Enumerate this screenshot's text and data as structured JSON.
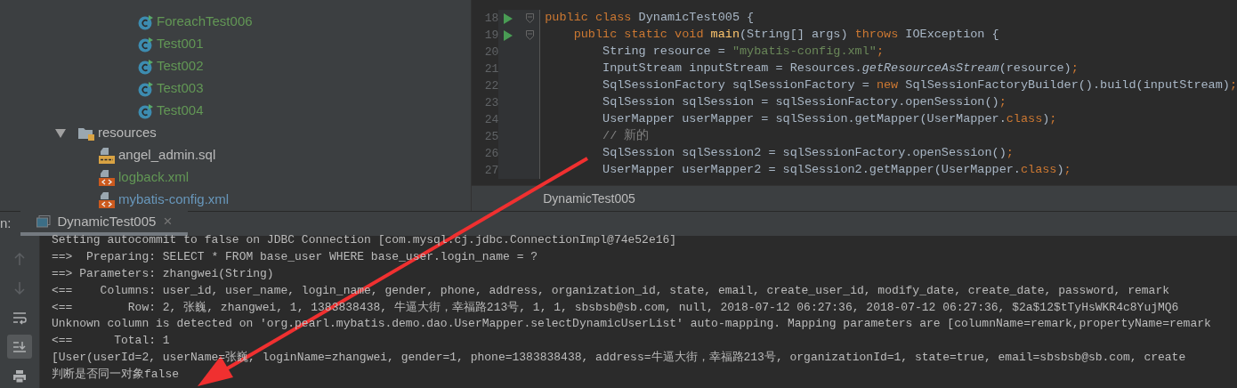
{
  "project_tree": [
    {
      "label": "ForeachTest006",
      "kind": "class",
      "selected": false,
      "color": "#629755"
    },
    {
      "label": "Test001",
      "kind": "class",
      "selected": false,
      "color": "#629755"
    },
    {
      "label": "Test002",
      "kind": "class",
      "selected": false,
      "color": "#629755"
    },
    {
      "label": "Test003",
      "kind": "class",
      "selected": false,
      "color": "#629755"
    },
    {
      "label": "Test004",
      "kind": "class",
      "selected": false,
      "color": "#629755"
    },
    {
      "label": "resources",
      "kind": "folder",
      "selected": false,
      "expanded": true,
      "color": "#bbbbbb",
      "children": [
        {
          "label": "angel_admin.sql",
          "kind": "sql",
          "selected": false,
          "color": "#bbbbbb"
        },
        {
          "label": "logback.xml",
          "kind": "xml",
          "selected": false,
          "color": "#629755"
        },
        {
          "label": "mybatis-config.xml",
          "kind": "xml",
          "selected": false,
          "color": "#6897bb"
        }
      ]
    }
  ],
  "editor": {
    "lines": [
      {
        "number": "18",
        "runnable": true,
        "foldable": true,
        "tokens": [
          {
            "kind": "keyword",
            "text": "public class "
          },
          {
            "kind": "plain",
            "text": "DynamicTest005 {"
          }
        ]
      },
      {
        "number": "19",
        "runnable": true,
        "foldable": true,
        "tokens": [
          {
            "kind": "keyword",
            "text": "    public static void "
          },
          {
            "kind": "method",
            "text": "main"
          },
          {
            "kind": "plain",
            "text": "(String[] args) "
          },
          {
            "kind": "keyword",
            "text": "throws "
          },
          {
            "kind": "plain",
            "text": "IOException {"
          }
        ]
      },
      {
        "number": "20",
        "runnable": false,
        "foldable": false,
        "tokens": [
          {
            "kind": "plain",
            "text": "        String resource = "
          },
          {
            "kind": "string",
            "text": "\"mybatis-config.xml\""
          },
          {
            "kind": "keyword",
            "text": ";"
          }
        ]
      },
      {
        "number": "21",
        "runnable": false,
        "foldable": false,
        "tokens": [
          {
            "kind": "plain",
            "text": "        InputStream inputStream = Resources."
          },
          {
            "kind": "static",
            "text": "getResourceAsStream"
          },
          {
            "kind": "plain",
            "text": "(resource)"
          },
          {
            "kind": "keyword",
            "text": ";"
          }
        ]
      },
      {
        "number": "22",
        "runnable": false,
        "foldable": false,
        "tokens": [
          {
            "kind": "plain",
            "text": "        SqlSessionFactory sqlSessionFactory = "
          },
          {
            "kind": "keyword",
            "text": "new "
          },
          {
            "kind": "plain",
            "text": "SqlSessionFactoryBuilder().build(inputStream)"
          },
          {
            "kind": "keyword",
            "text": ";"
          }
        ]
      },
      {
        "number": "23",
        "runnable": false,
        "foldable": false,
        "tokens": [
          {
            "kind": "plain",
            "text": "        SqlSession sqlSession = sqlSessionFactory.openSession()"
          },
          {
            "kind": "keyword",
            "text": ";"
          }
        ]
      },
      {
        "number": "24",
        "runnable": false,
        "foldable": false,
        "tokens": [
          {
            "kind": "plain",
            "text": "        UserMapper userMapper = sqlSession.getMapper(UserMapper."
          },
          {
            "kind": "keyword",
            "text": "class"
          },
          {
            "kind": "plain",
            "text": ")"
          },
          {
            "kind": "keyword",
            "text": ";"
          }
        ]
      },
      {
        "number": "25",
        "runnable": false,
        "foldable": false,
        "tokens": [
          {
            "kind": "comment",
            "text": "        // 新的"
          }
        ]
      },
      {
        "number": "26",
        "runnable": false,
        "foldable": false,
        "tokens": [
          {
            "kind": "plain",
            "text": "        SqlSession sqlSession2 = sqlSessionFactory.openSession()"
          },
          {
            "kind": "keyword",
            "text": ";"
          }
        ]
      },
      {
        "number": "27",
        "runnable": false,
        "foldable": false,
        "tokens": [
          {
            "kind": "plain",
            "text": "        UserMapper userMapper2 = sqlSession2.getMapper(UserMapper."
          },
          {
            "kind": "keyword",
            "text": "class"
          },
          {
            "kind": "plain",
            "text": ")"
          },
          {
            "kind": "keyword",
            "text": ";"
          }
        ]
      }
    ],
    "breadcrumb": "DynamicTest005"
  },
  "run_panel": {
    "label": "n:",
    "tabs": [
      {
        "label": "DynamicTest005",
        "selected": true,
        "close": "×"
      }
    ],
    "toolbar": [
      {
        "kind": "up",
        "disabled": true
      },
      {
        "kind": "down",
        "disabled": true
      },
      {
        "kind": "wrap",
        "selected": false
      },
      {
        "kind": "scroll-end",
        "selected": true
      },
      {
        "kind": "print",
        "selected": false
      }
    ],
    "console": [
      "Setting autocommit to false on JDBC Connection [com.mysql.cj.jdbc.ConnectionImpl@74e52e16]",
      "==>  Preparing: SELECT * FROM base_user WHERE base_user.login_name = ?",
      "==> Parameters: zhangwei(String)",
      "<==    Columns: user_id, user_name, login_name, gender, phone, address, organization_id, state, email, create_user_id, modify_date, create_date, password, remark",
      "<==        Row: 2, 张巍, zhangwei, 1, 1383838438, 牛逼大街，幸福路213号, 1, 1, sbsbsb@sb.com, null, 2018-07-12 06:27:36, 2018-07-12 06:27:36, $2a$12$tTyHsWKR4c8YujMQ6",
      "Unknown column is detected on 'org.pearl.mybatis.demo.dao.UserMapper.selectDynamicUserList' auto-mapping. Mapping parameters are [columnName=remark,propertyName=remark",
      "<==      Total: 1",
      "[User(userId=2, userName=张巍, loginName=zhangwei, gender=1, phone=1383838438, address=牛逼大街，幸福路213号, organizationId=1, state=true, email=sbsbsb@sb.com, create",
      "判断是否同一对象false"
    ]
  }
}
